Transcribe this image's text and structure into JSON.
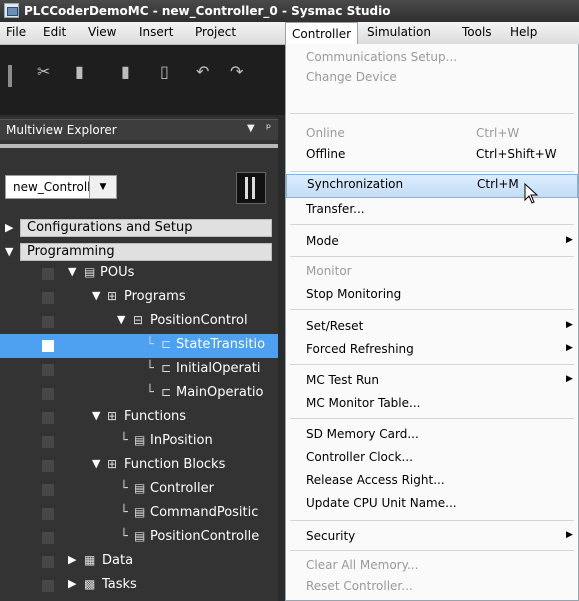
{
  "window": {
    "title": "PLCCoderDemoMC - new_Controller_0 - Sysmac Studio"
  },
  "menubar": {
    "items": [
      "File",
      "Edit",
      "View",
      "Insert",
      "Project",
      "Controller",
      "Simulation",
      "Tools",
      "Help"
    ],
    "active": "Controller"
  },
  "toolbar": {
    "icons": [
      "cut-icon",
      "copy-icon",
      "paste-icon",
      "delete-icon",
      "undo-icon",
      "redo-icon"
    ]
  },
  "explorer": {
    "title": "Multiview Explorer",
    "controller_select": "new_Controller_0",
    "sections": {
      "config": "Configurations and Setup",
      "programming": "Programming"
    },
    "tree": [
      {
        "label": "POUs",
        "icon": "▤"
      },
      {
        "label": "Programs",
        "icon": "⊞"
      },
      {
        "label": "PositionControl",
        "icon": "⊟"
      },
      {
        "label": "StateTransitio",
        "icon": "⊏"
      },
      {
        "label": "InitialOperati",
        "icon": "⊏"
      },
      {
        "label": "MainOperatio",
        "icon": "⊏"
      },
      {
        "label": "Functions",
        "icon": "⊞"
      },
      {
        "label": "InPosition",
        "icon": "▤"
      },
      {
        "label": "Function Blocks",
        "icon": "⊞"
      },
      {
        "label": "Controller",
        "icon": "▤"
      },
      {
        "label": "CommandPositic",
        "icon": "▤"
      },
      {
        "label": "PositionControlle",
        "icon": "▤"
      },
      {
        "label": "Data",
        "icon": "▦"
      },
      {
        "label": "Tasks",
        "icon": "▩"
      }
    ]
  },
  "controller_menu": {
    "items": {
      "comm_setup": "Communications Setup...",
      "change_device": "Change Device",
      "online": "Online",
      "online_sc": "Ctrl+W",
      "offline": "Offline",
      "offline_sc": "Ctrl+Shift+W",
      "sync": "Synchronization",
      "sync_sc": "Ctrl+M",
      "transfer": "Transfer...",
      "mode": "Mode",
      "monitor": "Monitor",
      "stop_mon": "Stop Monitoring",
      "set_reset": "Set/Reset",
      "forced": "Forced Refreshing",
      "mc_test": "MC Test Run",
      "mc_monitor": "MC Monitor Table...",
      "sd_card": "SD Memory Card...",
      "clock": "Controller Clock...",
      "release": "Release Access Right...",
      "update_cpu": "Update CPU Unit Name...",
      "security": "Security",
      "clear_mem": "Clear All Memory...",
      "reset_ctrl": "Reset Controller..."
    }
  }
}
